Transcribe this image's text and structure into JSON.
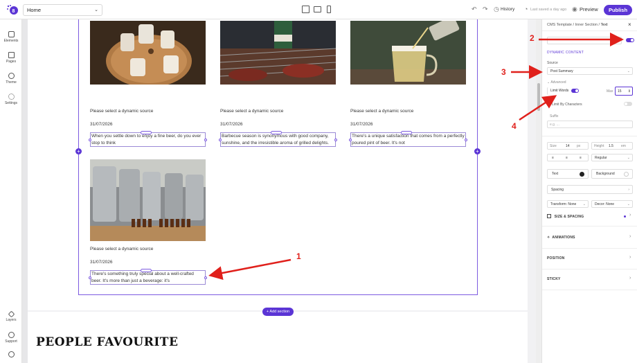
{
  "topbar": {
    "page_name": "Home",
    "history_label": "History",
    "saved_status": "Last saved a day ago",
    "preview_label": "Preview",
    "publish_label": "Publish"
  },
  "leftbar": {
    "items": [
      {
        "label": "Elements"
      },
      {
        "label": "Pages"
      },
      {
        "label": "Theme"
      },
      {
        "label": "Settings"
      }
    ],
    "bottom_items": [
      {
        "label": "Layers"
      },
      {
        "label": "Support"
      }
    ]
  },
  "cards": [
    {
      "caption": "Please select a dynamic source",
      "date": "31/07/2026",
      "summary": "When you settle down to enjoy a fine beer, do you ever stop to think"
    },
    {
      "caption": "Please select a dynamic source",
      "date": "31/07/2026",
      "summary": "Barbecue season is synonymous with good company, sunshine, and the irresistible aroma of grilled delights."
    },
    {
      "caption": "Please select a dynamic source",
      "date": "31/07/2026",
      "summary": "There's a unique satisfaction that comes from a perfectly poured pint of beer. It's not"
    },
    {
      "caption": "Please select a dynamic source",
      "date": "31/07/2026",
      "summary": "There's something truly special about a well-crafted beer. It's more than just a beverage: it's"
    }
  ],
  "canvas": {
    "add_section_label": "+ Add section",
    "section_title": "PEOPLE FAVOURITE"
  },
  "panel": {
    "breadcrumbs": [
      "CMS Template",
      "Inner Section",
      "Text"
    ],
    "dynamic_content_heading": "DYNAMIC CONTENT",
    "source_label": "Source",
    "source_value": "Post Summary",
    "advanced_label": "Advanced",
    "limit_words_label": "Limit Words",
    "max_label": "Max",
    "max_value": "15",
    "limit_chars_label": "Limit By Characters",
    "suffix_label": "Suffix",
    "suffix_placeholder": "e.g. ...",
    "size_label": "Size",
    "size_value": "14",
    "size_unit": "px",
    "height_label": "Height",
    "height_value": "1.5",
    "height_unit": "em",
    "weight_value": "Regular",
    "text_color_label": "Text",
    "bg_color_label": "Background",
    "spacing_label": "Spacing",
    "transform_label": "Transform: None",
    "decor_label": "Decor: None",
    "size_spacing_label": "SIZE & SPACING",
    "animations_label": "ANIMATIONS",
    "position_label": "POSITION",
    "sticky_label": "STICKY"
  },
  "annotations": {
    "one": "1",
    "two": "2",
    "three": "3",
    "four": "4"
  },
  "colors": {
    "accent": "#5b35d5",
    "annotation": "#e0201b"
  }
}
